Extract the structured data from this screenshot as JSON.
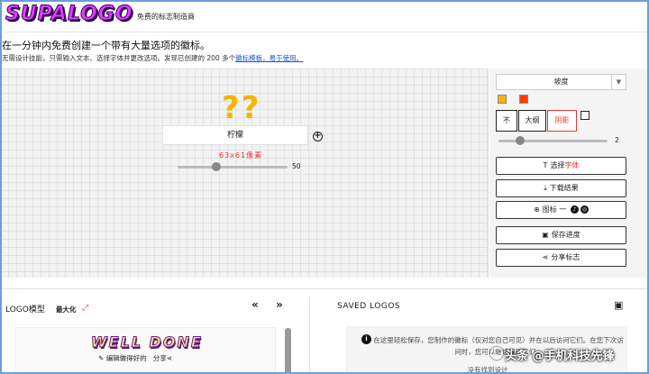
{
  "header": {
    "logo_text": "SUPALOGO",
    "tagline": "免费的标志制造商"
  },
  "intro": {
    "headline": "在一分钟内免费创建一个带有大量选项的徽标。",
    "subline_prefix": "无需设计技能，只需输入文本、选择字体并更改选项。发现已创建的 200 多个",
    "subline_link": "徽标模板，易于使用。"
  },
  "canvas": {
    "preview_text": "??",
    "text_value": "柠檬",
    "size_label": "63x61像素",
    "size_slider_value": "50",
    "size_slider_fraction": 0.35
  },
  "panel": {
    "effect_select": "坡度",
    "colors": [
      "#f6b400",
      "#ff3d00"
    ],
    "style_buttons": [
      {
        "label": "不"
      },
      {
        "label": "大纲"
      },
      {
        "label": "阴影"
      }
    ],
    "slider_value": "2",
    "slider_fraction": 0.2,
    "actions": {
      "choose_font_prefix": "选择",
      "choose_font_accent": "字体",
      "download": "下载结果",
      "icon": "图标 一",
      "save_progress": "保存进度",
      "share": "分享标志"
    }
  },
  "models": {
    "title": "LOGO模型",
    "maximize": "最大化",
    "prev": "«",
    "next": "»",
    "template_name": "WELL DONE",
    "edit_label": "编辑做得好的",
    "share_label": "分享"
  },
  "saved": {
    "title": "SAVED LOGOS",
    "message": "在这里轻松保存，您制作的徽标（仅对您自己可见）并在以后访问它们。在您下次访问时，您可以继续编辑它们。",
    "empty": "没有找到设计"
  },
  "watermark": {
    "text": "头条 @手机科技先锋"
  }
}
